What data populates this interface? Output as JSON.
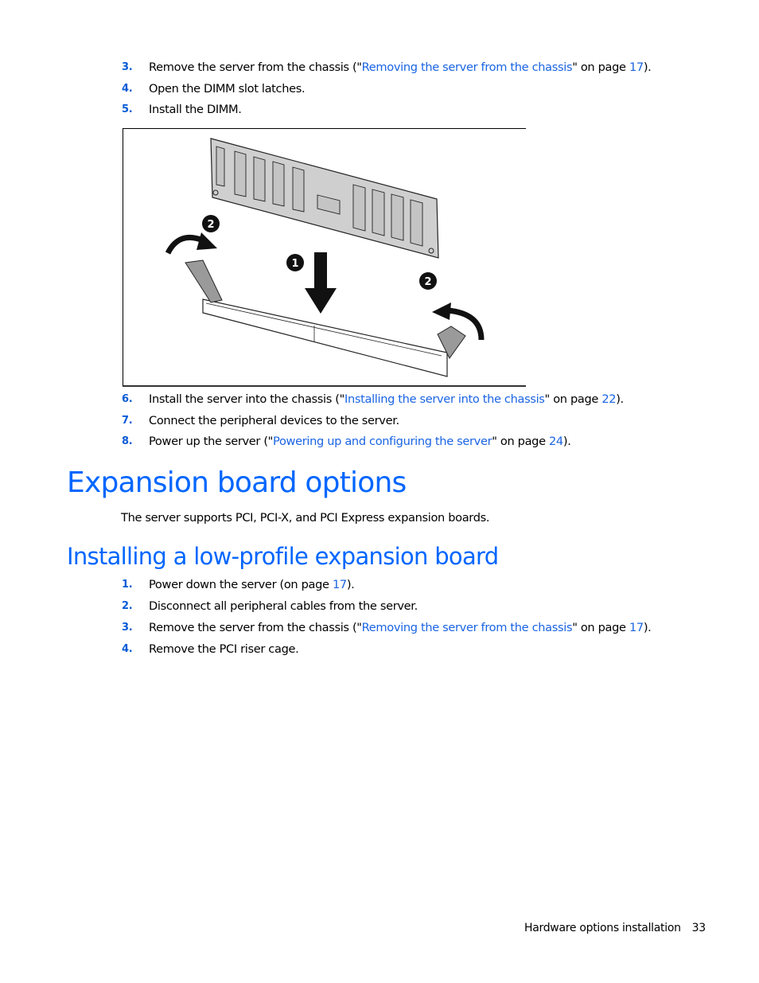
{
  "steps_top": [
    {
      "num": "3.",
      "pre": "Remove the server from the chassis (\"",
      "link": "Removing the server from the chassis",
      "mid": "\" on page ",
      "page": "17",
      "post": ")."
    },
    {
      "num": "4.",
      "pre": "Open the DIMM slot latches.",
      "link": "",
      "mid": "",
      "page": "",
      "post": ""
    },
    {
      "num": "5.",
      "pre": "Install the DIMM.",
      "link": "",
      "mid": "",
      "page": "",
      "post": ""
    }
  ],
  "figure": {
    "callouts": [
      "1",
      "2",
      "2"
    ],
    "description": "DIMM installation: insert module into slot, close latches"
  },
  "steps_mid": [
    {
      "num": "6.",
      "pre": "Install the server into the chassis (\"",
      "link": "Installing the server into the chassis",
      "mid": "\" on page ",
      "page": "22",
      "post": ")."
    },
    {
      "num": "7.",
      "pre": "Connect the peripheral devices to the server.",
      "link": "",
      "mid": "",
      "page": "",
      "post": ""
    },
    {
      "num": "8.",
      "pre": "Power up the server (\"",
      "link": "Powering up and configuring the server",
      "mid": "\" on page ",
      "page": "24",
      "post": ")."
    }
  ],
  "section": {
    "title": "Expansion board options",
    "body": "The server supports PCI, PCI-X, and PCI Express expansion boards."
  },
  "subsection": {
    "title": "Installing a low-profile expansion board"
  },
  "steps_bottom": [
    {
      "num": "1.",
      "pre": "Power down the server (on page ",
      "link": "",
      "mid": "",
      "page": "17",
      "post": ")."
    },
    {
      "num": "2.",
      "pre": "Disconnect all peripheral cables from the server.",
      "link": "",
      "mid": "",
      "page": "",
      "post": ""
    },
    {
      "num": "3.",
      "pre": "Remove the server from the chassis (\"",
      "link": "Removing the server from the chassis",
      "mid": "\" on page ",
      "page": "17",
      "post": ")."
    },
    {
      "num": "4.",
      "pre": "Remove the PCI riser cage.",
      "link": "",
      "mid": "",
      "page": "",
      "post": ""
    }
  ],
  "footer": {
    "section": "Hardware options installation",
    "page": "33"
  }
}
